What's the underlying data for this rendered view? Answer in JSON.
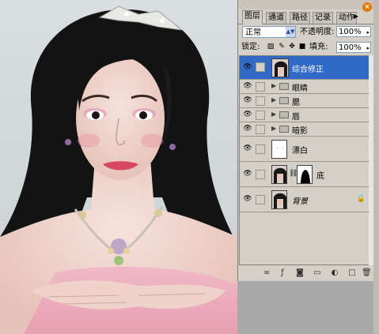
{
  "palette": {
    "tabs": [
      "图层",
      "通道",
      "路径",
      "记录",
      "动作"
    ],
    "active_tab": "图层",
    "blend_mode": "正常",
    "opacity_label": "不透明度:",
    "opacity_value": "100%",
    "lock_label": "锁定:",
    "fill_label": "填充:",
    "fill_value": "100%",
    "layers": [
      {
        "name": "综合修正",
        "selected": true,
        "kind": "adjust"
      },
      {
        "name": "眼睛",
        "selected": false,
        "kind": "group"
      },
      {
        "name": "腮",
        "selected": false,
        "kind": "group"
      },
      {
        "name": "唇",
        "selected": false,
        "kind": "group"
      },
      {
        "name": "暗影",
        "selected": false,
        "kind": "group"
      },
      {
        "name": "漂白",
        "selected": false,
        "kind": "white"
      },
      {
        "name": "底",
        "selected": false,
        "kind": "masked"
      },
      {
        "name": "背景",
        "selected": false,
        "kind": "background"
      }
    ],
    "icons": [
      "link-icon",
      "layer-style-icon",
      "mask-icon",
      "new-group-icon",
      "adjustment-layer-icon",
      "new-layer-icon",
      "trash-icon"
    ]
  }
}
